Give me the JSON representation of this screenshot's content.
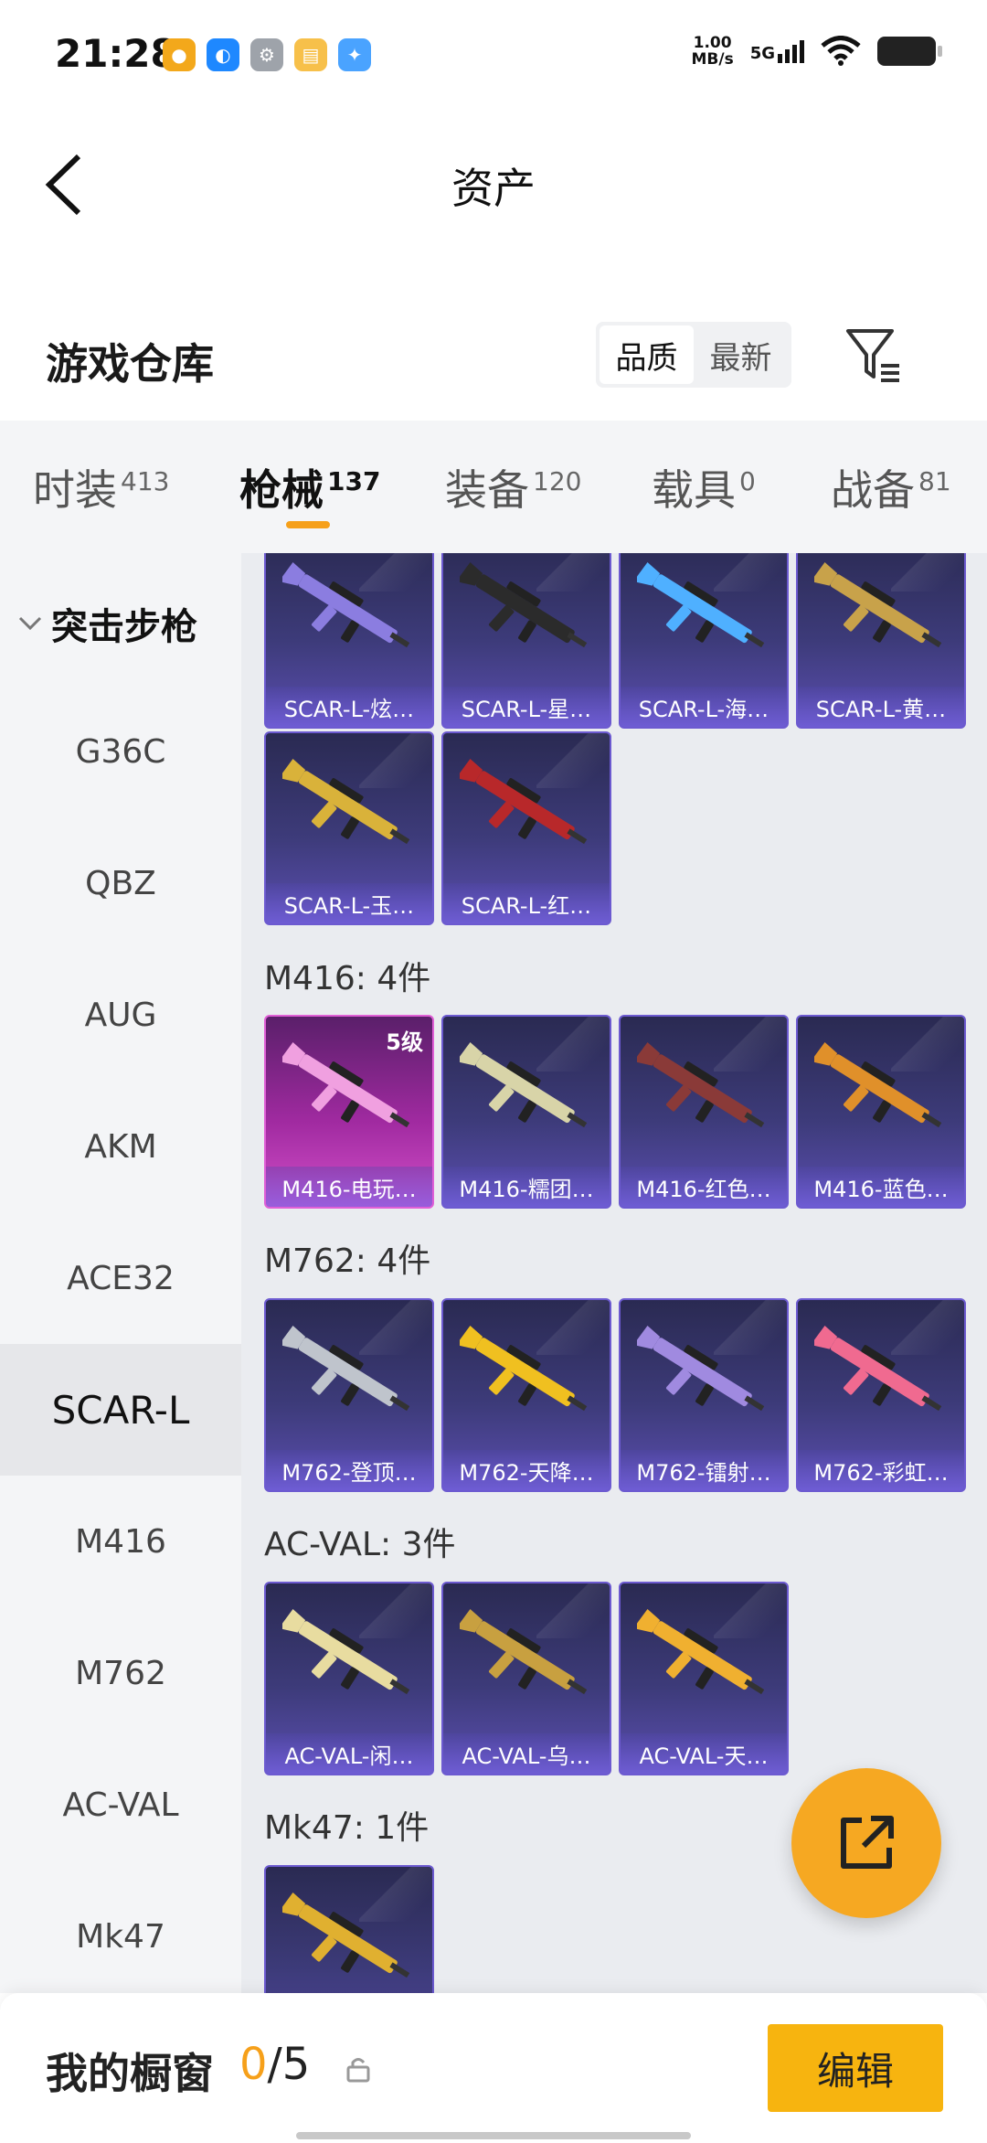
{
  "status": {
    "time": "21:28",
    "net_speed_top": "1.00",
    "net_speed_bottom": "MB/s",
    "signal_label": "5G",
    "apps": [
      {
        "icon": "game-app-icon",
        "color": "#f3a81b"
      },
      {
        "icon": "browser-app-icon",
        "color": "#1e88ff"
      },
      {
        "icon": "settings-app-icon",
        "color": "#9ea3aa"
      },
      {
        "icon": "news-app-icon",
        "color": "#f7c04a"
      },
      {
        "icon": "assistant-app-icon",
        "color": "#4aa3ff"
      }
    ]
  },
  "header": {
    "title": "资产"
  },
  "warehouse": {
    "title": "游戏仓库",
    "sort_options": [
      "品质",
      "最新"
    ],
    "sort_active": "品质"
  },
  "tabs": [
    {
      "label": "时装",
      "count": "413"
    },
    {
      "label": "枪械",
      "count": "137"
    },
    {
      "label": "装备",
      "count": "120"
    },
    {
      "label": "载具",
      "count": "0"
    },
    {
      "label": "战备",
      "count": "81"
    }
  ],
  "sidebar": {
    "category": "突击步枪",
    "items": [
      "G36C",
      "QBZ",
      "AUG",
      "AKM",
      "ACE32",
      "SCAR-L",
      "M416",
      "M762",
      "AC-VAL",
      "Mk47"
    ],
    "active": "SCAR-L"
  },
  "sections": {
    "scar_cards": [
      "SCAR-L-炫…",
      "SCAR-L-星…",
      "SCAR-L-海…",
      "SCAR-L-黄…",
      "SCAR-L-玉…",
      "SCAR-L-红…"
    ],
    "m416_title": "M416: 4件",
    "m416_cards": [
      "M416-电玩…",
      "M416-糯团…",
      "M416-红色…",
      "M416-蓝色…"
    ],
    "m416_level": "5级",
    "m762_title": "M762: 4件",
    "m762_cards": [
      "M762-登顶…",
      "M762-天降…",
      "M762-镭射…",
      "M762-彩虹…"
    ],
    "acval_title": "AC-VAL: 3件",
    "acval_cards": [
      "AC-VAL-闲…",
      "AC-VAL-乌…",
      "AC-VAL-天…"
    ],
    "mk47_title": "Mk47: 1件"
  },
  "gun_colors": [
    "#8b7de0",
    "#2b2b2b",
    "#4fb0ff",
    "#c8a24a",
    "#d9b23a",
    "#b8282a",
    "#f0a0e0",
    "#d8d4a8",
    "#8a3a38",
    "#e0902a",
    "#bfc4cc",
    "#f0c020",
    "#a08ae0",
    "#f06a90",
    "#e8dca0",
    "#c8a040",
    "#f0b030",
    "#e0b030"
  ],
  "bottom": {
    "title": "我的橱窗",
    "count_current": "0",
    "count_total": "/5",
    "edit_label": "编辑"
  }
}
